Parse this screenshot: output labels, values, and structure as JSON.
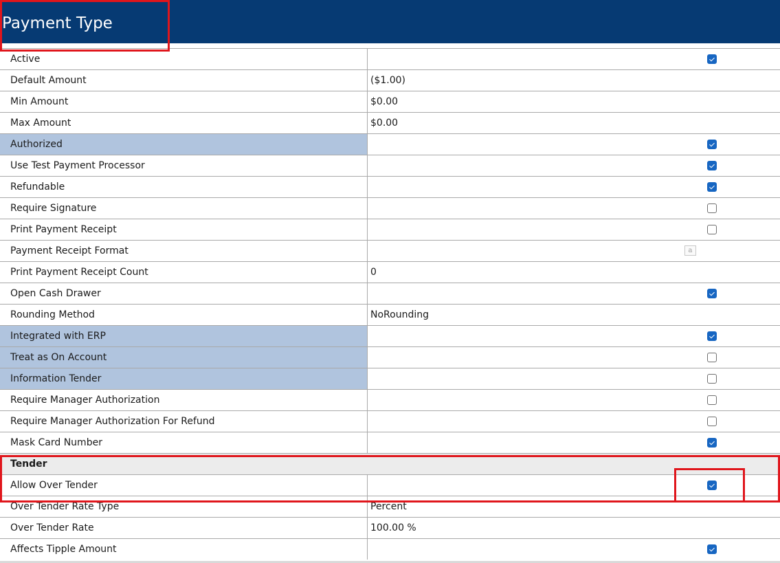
{
  "header": {
    "title": "Payment Type"
  },
  "colors": {
    "header_bg": "#063a73",
    "highlight_row": "#b0c4de",
    "checkbox_on": "#1766c2",
    "annotation": "#e0161c"
  },
  "rows_main": [
    {
      "label": "Active",
      "checkbox": true
    },
    {
      "label": "Default Amount",
      "value": "($1.00)"
    },
    {
      "label": "Min Amount",
      "value": "$0.00"
    },
    {
      "label": "Max Amount",
      "value": "$0.00"
    },
    {
      "label": "Authorized",
      "checkbox": true,
      "highlighted": true
    },
    {
      "label": "Use Test Payment Processor",
      "checkbox": true
    },
    {
      "label": "Refundable",
      "checkbox": true
    },
    {
      "label": "Require Signature",
      "checkbox": false
    },
    {
      "label": "Print Payment Receipt",
      "checkbox": false
    },
    {
      "label": "Payment Receipt Format",
      "icon": "format-string-icon"
    },
    {
      "label": "Print Payment Receipt Count",
      "value": "0"
    },
    {
      "label": "Open Cash Drawer",
      "checkbox": true
    },
    {
      "label": "Rounding Method",
      "value": "NoRounding"
    },
    {
      "label": "Integrated with ERP",
      "checkbox": true,
      "highlighted": true
    },
    {
      "label": "Treat as On Account",
      "checkbox": false,
      "highlighted": true
    },
    {
      "label": "Information Tender",
      "checkbox": false,
      "highlighted": true
    },
    {
      "label": "Require Manager Authorization",
      "checkbox": false
    },
    {
      "label": "Require Manager Authorization For Refund",
      "checkbox": false
    },
    {
      "label": "Mask Card Number",
      "checkbox": true
    }
  ],
  "section": {
    "label": "Tender"
  },
  "rows_tender": [
    {
      "label": "Allow Over Tender",
      "checkbox": true
    },
    {
      "label": "Over Tender Rate Type",
      "value": "Percent"
    },
    {
      "label": "Over Tender Rate",
      "value": "100.00 %"
    },
    {
      "label": "Affects Tipple Amount",
      "checkbox": true
    }
  ]
}
